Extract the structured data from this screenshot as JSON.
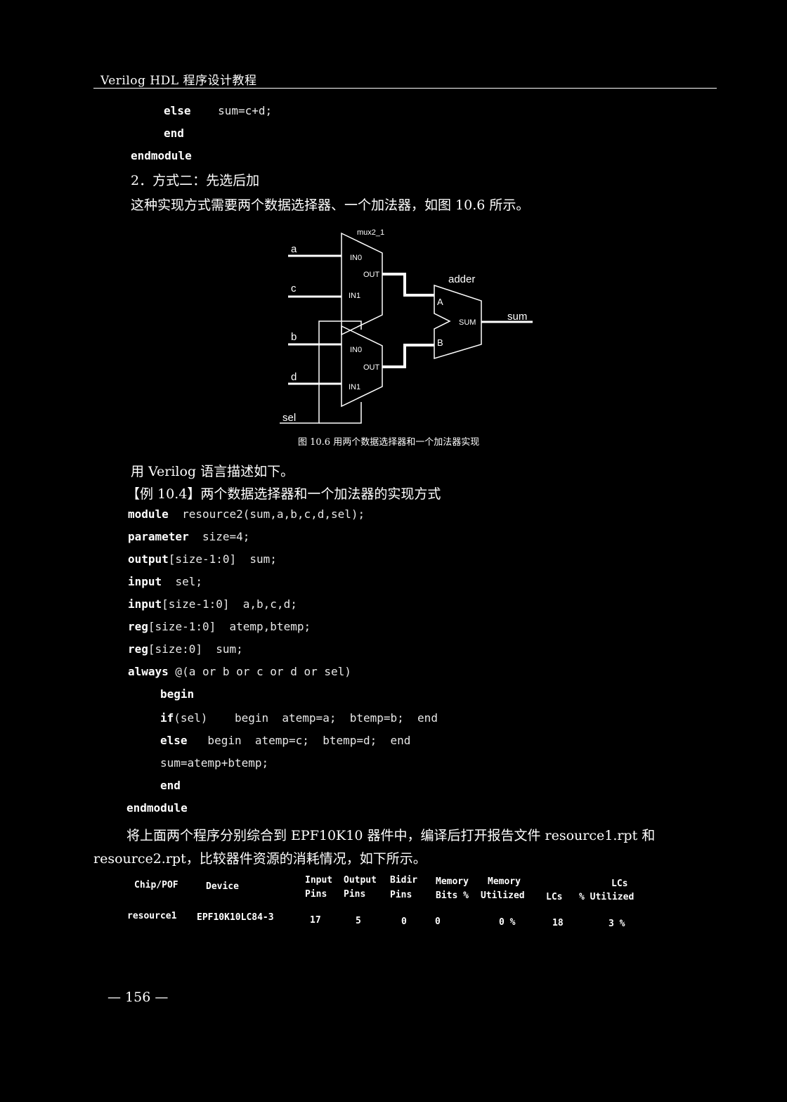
{
  "running_head": "Verilog HDL 程序设计教程",
  "code_top": [
    {
      "kw": "else",
      "rest": "    sum=c+d;"
    },
    {
      "kw": "end",
      "rest": ""
    },
    {
      "kw": "endmodule",
      "rest": ""
    }
  ],
  "section_heading": "2．方式二：先选后加",
  "intro_text": "这种实现方式需要两个数据选择器、一个加法器，如图 10.6 所示。",
  "figure": {
    "mux_label": "mux2_1",
    "adder_label": "adder",
    "inputs": [
      "a",
      "c",
      "b",
      "d",
      "sel"
    ],
    "port_in0": "IN0",
    "port_in1": "IN1",
    "port_out": "OUT",
    "port_a": "A",
    "port_b": "B",
    "port_sum": "SUM",
    "output": "sum",
    "caption": "图 10.6  用两个数据选择器和一个加法器实现"
  },
  "describe_text": "用 Verilog 语言描述如下。",
  "example_title": "【例 10.4】两个数据选择器和一个加法器的实现方式",
  "code_example": [
    {
      "kw": "module",
      "rest": "  resource2(sum,a,b,c,d,sel);"
    },
    {
      "kw": "parameter",
      "rest": "  size=4;"
    },
    {
      "kw": "output",
      "rest": "[size-1:0]  sum;"
    },
    {
      "kw": "input",
      "rest": "  sel;"
    },
    {
      "kw": "input",
      "rest": "[size-1:0]  a,b,c,d;"
    },
    {
      "kw": "reg",
      "rest": "[size-1:0]  atemp,btemp;"
    },
    {
      "kw": "reg",
      "rest": "[size:0]  sum;"
    },
    {
      "kw": "always",
      "rest": " @(a or b or c or d or sel)"
    },
    {
      "kw": "begin",
      "rest": ""
    },
    {
      "kw": "if",
      "rest": "(sel)    begin  atemp=a;  btemp=b;  end"
    },
    {
      "kw": "else",
      "rest": "   begin  atemp=c;  btemp=d;  end"
    },
    {
      "kw": "",
      "rest": "sum=atemp+btemp;"
    },
    {
      "kw": "end",
      "rest": ""
    },
    {
      "kw": "endmodule",
      "rest": ""
    }
  ],
  "closing_line1": "将上面两个程序分别综合到 EPF10K10 器件中，编译后打开报告文件 resource1.rpt 和",
  "closing_line2": "resource2.rpt，比较器件资源的消耗情况，如下所示。",
  "report_table": {
    "headers_top": [
      "Chip/POF",
      "Device",
      "Input",
      "Output",
      "Bidir",
      "Memory",
      "Memory",
      "",
      "LCs"
    ],
    "headers_bottom": [
      "",
      "",
      "Pins",
      "Pins",
      "Pins",
      "Bits %",
      "Utilized",
      "LCs",
      "% Utilized"
    ],
    "row": [
      "resource1",
      "EPF10K10LC84-3",
      "17",
      "5",
      "0",
      "0",
      "0  %",
      "18",
      "3  %"
    ]
  },
  "page_number": "— 156 —"
}
